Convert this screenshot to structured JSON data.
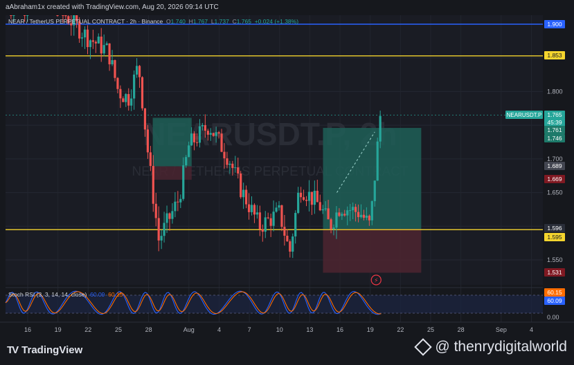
{
  "header": {
    "credit": "aAbraham1x created with TradingView.com, Aug 20, 2026 09:14 UTC"
  },
  "legend": {
    "symbol": "NEAR / TetherUS PERPETUAL CONTRACT · 2h · Binance",
    "open_label": "O",
    "open": "1.740",
    "high_label": "H",
    "high": "1.767",
    "low_label": "L",
    "low": "1.737",
    "close_label": "C",
    "close": "1.765",
    "change": "+0.024 (+1.38%)"
  },
  "watermark": {
    "ticker": "NEARUSDT.P, 2h",
    "name": "NEAR / TETHERUS PERPETUAL CONTRACT"
  },
  "stoch_legend": {
    "label": "Stoch RSI (3, 3, 14, 14, close)",
    "k": "60.09",
    "d": "60.15"
  },
  "price_axis": {
    "ticks": [
      "1.800",
      "1.750",
      "1.700",
      "1.650",
      "1.550"
    ],
    "labels": [
      {
        "text": "1.900",
        "bg": "#2962ff",
        "fg": "#ffffff"
      },
      {
        "text": "1.853",
        "bg": "#f5d52e",
        "fg": "#131722"
      },
      {
        "text": "1.765",
        "bg": "#26a69a",
        "fg": "#ffffff"
      },
      {
        "text": "45:39",
        "bg": "#26a69a",
        "fg": "#ffffff"
      },
      {
        "text": "1.761",
        "bg": "#1e7a6a",
        "fg": "#ffffff"
      },
      {
        "text": "1.746",
        "bg": "#1e7a6a",
        "fg": "#ffffff"
      },
      {
        "text": "1.689",
        "bg": "#434651",
        "fg": "#ffffff"
      },
      {
        "text": "1.669",
        "bg": "#801922",
        "fg": "#ffffff"
      },
      {
        "text": "1.596",
        "bg": "#2a2e39",
        "fg": "#ffffff"
      },
      {
        "text": "1.595",
        "bg": "#f5d52e",
        "fg": "#131722"
      },
      {
        "text": "1.531",
        "bg": "#801922",
        "fg": "#ffffff"
      }
    ],
    "symbol_tag": "NEARUSDT.P"
  },
  "stoch_axis": {
    "ticks": [
      "0.00"
    ],
    "labels": [
      {
        "text": "60.15",
        "bg": "#ff6d00",
        "fg": "#ffffff"
      },
      {
        "text": "60.09",
        "bg": "#2962ff",
        "fg": "#ffffff"
      }
    ]
  },
  "time_axis": [
    "16",
    "19",
    "22",
    "25",
    "28",
    "Aug",
    "4",
    "7",
    "10",
    "13",
    "16",
    "19",
    "22",
    "25",
    "28",
    "Sep",
    "4"
  ],
  "footer": {
    "brand": "TradingView",
    "handle": "@ thenrydigitalworld"
  },
  "colors": {
    "up": "#26a69a",
    "down": "#ef5350",
    "resistance": "#f5d52e",
    "upper_line": "#2962ff",
    "profit_zone": "#1f5f57",
    "loss_zone": "#4a2530"
  },
  "chart_data": {
    "type": "candlestick",
    "symbol": "NEAR / TetherUS PERPETUAL CONTRACT",
    "timeframe": "2h",
    "exchange": "Binance",
    "y_range": [
      1.515,
      1.91
    ],
    "horizontal_lines": [
      {
        "price": 1.9,
        "color": "#2962ff"
      },
      {
        "price": 1.853,
        "color": "#f5d52e"
      },
      {
        "price": 1.595,
        "color": "#f5d52e"
      }
    ],
    "position_tool": {
      "entry": 1.596,
      "target": 1.746,
      "stop": 1.531
    },
    "zones": [
      {
        "from_date": "Jul 28",
        "to_date": "Aug 1",
        "top": 1.761,
        "bottom": 1.689,
        "kind": "profit"
      },
      {
        "from_date": "Jul 28",
        "to_date": "Aug 1",
        "top": 1.689,
        "bottom": 1.669,
        "kind": "loss"
      }
    ],
    "price_path": [
      {
        "date": "Jul 14",
        "price": 1.93
      },
      {
        "date": "Jul 18",
        "price": 1.94
      },
      {
        "date": "Jul 22",
        "price": 1.88
      },
      {
        "date": "Jul 24",
        "price": 1.86
      },
      {
        "date": "Jul 25",
        "price": 1.8
      },
      {
        "date": "Jul 26",
        "price": 1.79
      },
      {
        "date": "Jul 27",
        "price": 1.84
      },
      {
        "date": "Jul 28",
        "price": 1.7
      },
      {
        "date": "Jul 29",
        "price": 1.58
      },
      {
        "date": "Jul 31",
        "price": 1.64
      },
      {
        "date": "Aug 1",
        "price": 1.72
      },
      {
        "date": "Aug 3",
        "price": 1.75
      },
      {
        "date": "Aug 5",
        "price": 1.7
      },
      {
        "date": "Aug 6",
        "price": 1.66
      },
      {
        "date": "Aug 8",
        "price": 1.6
      },
      {
        "date": "Aug 10",
        "price": 1.62
      },
      {
        "date": "Aug 11",
        "price": 1.56
      },
      {
        "date": "Aug 12",
        "price": 1.66
      },
      {
        "date": "Aug 14",
        "price": 1.63
      },
      {
        "date": "Aug 15",
        "price": 1.6
      },
      {
        "date": "Aug 16",
        "price": 1.63
      },
      {
        "date": "Aug 18",
        "price": 1.62
      },
      {
        "date": "Aug 19",
        "price": 1.6
      },
      {
        "date": "Aug 20",
        "price": 1.765
      }
    ],
    "stoch_rsi": {
      "k": 60.09,
      "d": 60.15,
      "range": [
        0,
        100
      ]
    }
  }
}
